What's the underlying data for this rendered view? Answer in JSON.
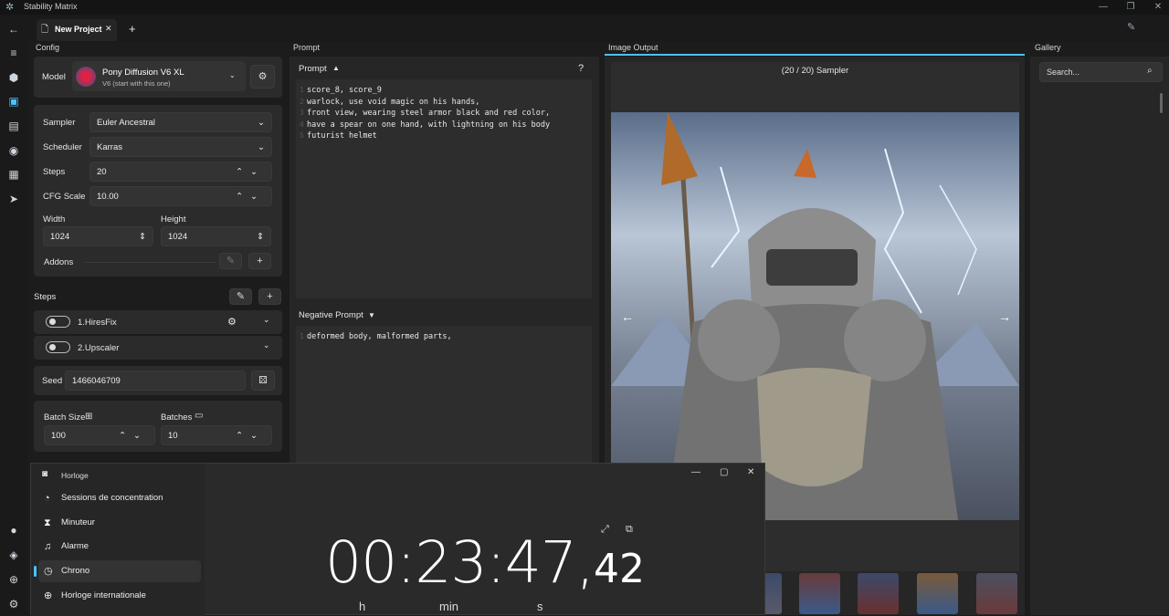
{
  "app": {
    "title": "Stability Matrix"
  },
  "tab": {
    "label": "New Project",
    "close": "✕",
    "add": "+"
  },
  "panels": {
    "config": "Config",
    "prompt": "Prompt",
    "image_output": "Image Output",
    "gallery": "Gallery"
  },
  "model": {
    "label": "Model",
    "name": "Pony Diffusion V6 XL",
    "version": "V6 (start with this one)"
  },
  "sampler": {
    "label": "Sampler",
    "value": "Euler Ancestral"
  },
  "scheduler": {
    "label": "Scheduler",
    "value": "Karras"
  },
  "steps": {
    "label": "Steps",
    "value": "20"
  },
  "cfg": {
    "label": "CFG Scale",
    "value": "10.00"
  },
  "width": {
    "label": "Width",
    "value": "1024"
  },
  "height": {
    "label": "Height",
    "value": "1024"
  },
  "addons": {
    "label": "Addons"
  },
  "steps_section": {
    "label": "Steps",
    "items": [
      {
        "label": "1.HiresFix"
      },
      {
        "label": "2.Upscaler"
      }
    ]
  },
  "seed": {
    "label": "Seed",
    "value": "1466046709"
  },
  "batch": {
    "size_label": "Batch Size",
    "size_value": "100",
    "batches_label": "Batches",
    "batches_value": "10"
  },
  "prompt": {
    "label": "Prompt",
    "help": "?",
    "lines": [
      "score_8, score_9",
      "warlock, use void magic on his hands,",
      "front view, wearing steel armor black and red color,",
      "have a spear on one hand, with lightning  on his body",
      "futurist helmet"
    ]
  },
  "negative_prompt": {
    "label": "Negative Prompt",
    "lines": [
      "deformed body, malformed parts,"
    ]
  },
  "output": {
    "status": "(20 / 20) Sampler"
  },
  "gallery": {
    "search_placeholder": "Search..."
  },
  "clock": {
    "app_name": "Horloge",
    "nav": [
      "Sessions de concentration",
      "Minuteur",
      "Alarme",
      "Chrono",
      "Horloge internationale"
    ],
    "active": "Chrono",
    "time_main": "00:23:47,",
    "time_frac": "42",
    "unit_h": "h",
    "unit_min": "min",
    "unit_s": "s"
  },
  "colors": {
    "accent": "#4cc2ff",
    "panel": "#2b2b2b",
    "bg": "#1c1c1c"
  }
}
